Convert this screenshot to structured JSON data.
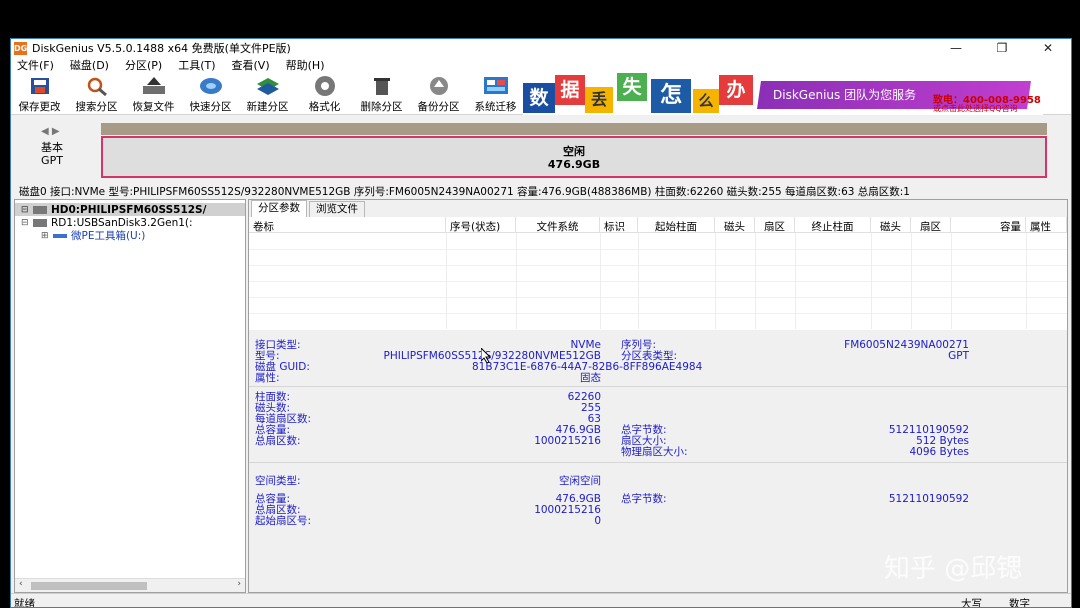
{
  "window": {
    "title": "DiskGenius V5.5.0.1488 x64 免费版(单文件PE版)",
    "icon_text": "DG"
  },
  "menu": [
    "文件(F)",
    "磁盘(D)",
    "分区(P)",
    "工具(T)",
    "查看(V)",
    "帮助(H)"
  ],
  "toolbar": [
    {
      "label": "保存更改",
      "icon": "save-icon"
    },
    {
      "label": "搜索分区",
      "icon": "search-icon"
    },
    {
      "label": "恢复文件",
      "icon": "recover-icon"
    },
    {
      "label": "快速分区",
      "icon": "quick-partition-icon"
    },
    {
      "label": "新建分区",
      "icon": "new-partition-icon"
    },
    {
      "label": "格式化",
      "icon": "format-icon"
    },
    {
      "label": "删除分区",
      "icon": "delete-icon"
    },
    {
      "label": "备份分区",
      "icon": "backup-icon"
    },
    {
      "label": "系统迁移",
      "icon": "migrate-icon"
    }
  ],
  "banner": {
    "tiles": [
      "数",
      "据",
      "丢",
      "失",
      "怎",
      "么",
      "办"
    ],
    "slogan": "DiskGenius 团队为您服务",
    "hotline": "致电：400-008-9958",
    "hotline_sub": "或点击此处选择QQ咨询"
  },
  "disk_map": {
    "nav": "◀ ▶",
    "disk_type": "基本",
    "table_type": "GPT",
    "free_label": "空闲",
    "free_size": "476.9GB"
  },
  "disk_info_line": "磁盘0 接口:NVMe  型号:PHILIPSFM60SS512S/932280NVME512GB  序列号:FM6005N2439NA00271  容量:476.9GB(488386MB)  柱面数:62260  磁头数:255  每道扇区数:63  总扇区数:1",
  "tree": [
    {
      "label": "HD0:PHILIPSFM60SS512S/",
      "selected": true
    },
    {
      "label": "RD1:USBSanDisk3.2Gen1(:",
      "selected": false
    },
    {
      "label": "微PE工具箱(U:)",
      "selected": false
    }
  ],
  "tabs": [
    "分区参数",
    "浏览文件"
  ],
  "columns": [
    "卷标",
    "序号(状态)",
    "文件系统",
    "标识",
    "起始柱面",
    "磁头",
    "扇区",
    "终止柱面",
    "磁头",
    "扇区",
    "容量",
    "属性"
  ],
  "params": {
    "interface_label": "接口类型:",
    "interface_value": "NVMe",
    "serial_label": "序列号:",
    "serial_value": "FM6005N2439NA00271",
    "model_label": "型号:",
    "model_value": "PHILIPSFM60SS512S/932280NVME512GB",
    "table_label": "分区表类型:",
    "table_value": "GPT",
    "guid_label": "磁盘 GUID:",
    "guid_value": "81B73C1E-6876-44A7-82B6-8FF896AE4984",
    "attr_label": "属性:",
    "attr_value": "固态",
    "cyl_label": "柱面数:",
    "cyl_value": "62260",
    "heads_label": "磁头数:",
    "heads_value": "255",
    "spt_label": "每道扇区数:",
    "spt_value": "63",
    "cap_label": "总容量:",
    "cap_value": "476.9GB",
    "bytes_label": "总字节数:",
    "bytes_value": "512110190592",
    "sectors_label": "总扇区数:",
    "sectors_value": "1000215216",
    "sector_size_label": "扇区大小:",
    "sector_size_value": "512 Bytes",
    "phys_sector_label": "物理扇区大小:",
    "phys_sector_value": "4096 Bytes",
    "space_type_label": "空间类型:",
    "space_type_value": "空闲空间",
    "free_cap_label": "总容量:",
    "free_cap_value": "476.9GB",
    "free_bytes_label": "总字节数:",
    "free_bytes_value": "512110190592",
    "free_sectors_label": "总扇区数:",
    "free_sectors_value": "1000215216",
    "start_sector_label": "起始扇区号:",
    "start_sector_value": "0"
  },
  "status": {
    "left": "就绪",
    "caps": "大写",
    "num": "数字"
  },
  "watermark": "知乎 @邱锶"
}
